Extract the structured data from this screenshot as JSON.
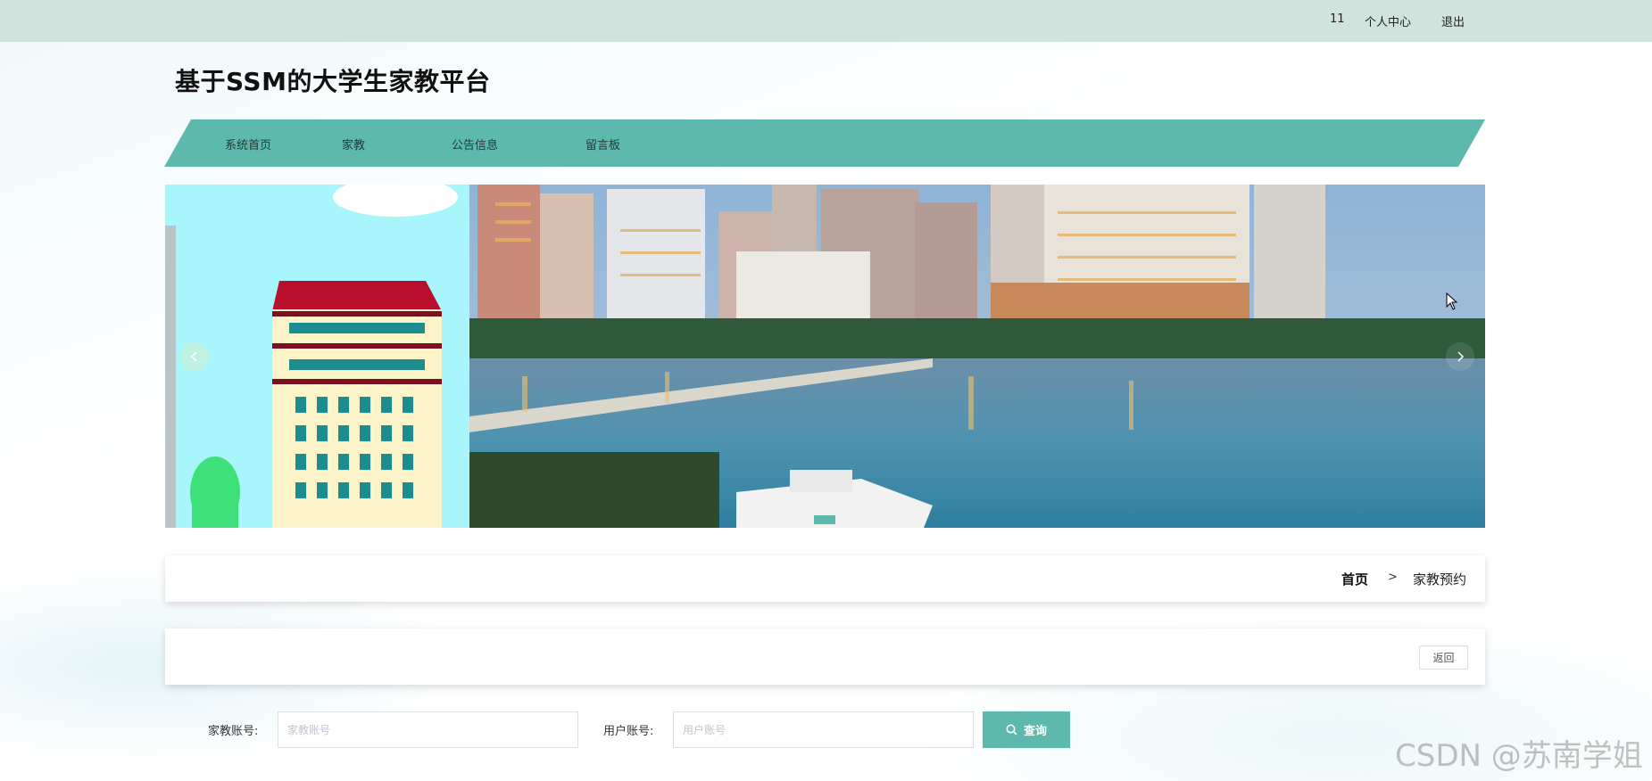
{
  "topbar": {
    "username": "11",
    "personal_center": "个人中心",
    "logout": "退出"
  },
  "header": {
    "site_title": "基于SSM的大学生家教平台"
  },
  "nav": {
    "items": [
      {
        "label": "系统首页"
      },
      {
        "label": "家教"
      },
      {
        "label": "公告信息"
      },
      {
        "label": "留言板"
      }
    ]
  },
  "carousel": {
    "prev_icon": "chevron-left-icon",
    "next_icon": "chevron-right-icon",
    "slides": [
      "campus-building-illustration",
      "city-waterfront-photo"
    ]
  },
  "breadcrumb": {
    "home": "首页",
    "separator": ">",
    "current": "家教预约"
  },
  "actions": {
    "back_label": "返回"
  },
  "search": {
    "tutor_account_label": "家教账号:",
    "tutor_account_placeholder": "家教账号",
    "user_account_label": "用户账号:",
    "user_account_placeholder": "用户账号",
    "query_label": "查询",
    "query_icon": "search-icon"
  },
  "watermark": "CSDN @苏南学姐",
  "colors": {
    "accent": "#5db8ae",
    "topbar": "#cfe4dd"
  }
}
